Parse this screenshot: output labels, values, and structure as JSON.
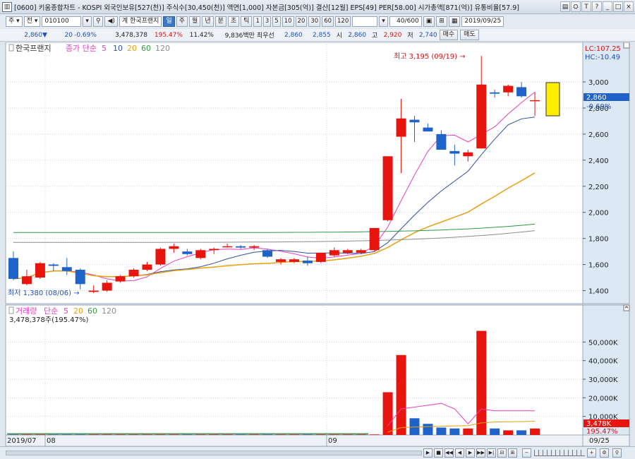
{
  "titlebar": {
    "icon": "chart-window-icon",
    "text": "[0600] 키움종합차트 - KOSPI 외국인보유[527(천)] 주식수[30,450(천)] 액면[1,000] 자본금[305(억)] 결산[12월] EPS[49] PER[58.00] 시가총액[871(억)] 유통비율[57.9]",
    "buttons": [
      "▤",
      "⛭",
      "T",
      "?",
      "_",
      "□",
      "×"
    ]
  },
  "toolbar1": {
    "market": "주",
    "scope": "전",
    "code": "010100",
    "stock_name_prefix": "계",
    "stock_name": "한국프랜지",
    "periods": [
      "일",
      "주",
      "월",
      "년",
      "분",
      "초",
      "틱"
    ],
    "selected_period": "일",
    "minutes": [
      "1",
      "3",
      "5",
      "10",
      "20",
      "30",
      "60",
      "120"
    ],
    "count": "40/600",
    "date": "2019/09/25"
  },
  "quote": {
    "price": "2,860",
    "change": "20",
    "change_pct": "-0.69%",
    "volume": "3,478,378",
    "volume_ratio": "195.47%",
    "turnover": "11.42%",
    "amount": "9,836백만",
    "best_label": "최우선",
    "ask": "2,860",
    "bid": "2,855",
    "open_label": "시",
    "open": "2,860",
    "high_label": "고",
    "high": "2,920",
    "low_label": "저",
    "low": "2,740",
    "buy_label": "매수",
    "sell_label": "매도"
  },
  "price_pane": {
    "legend_name": "한국프랜지",
    "ma_label": "종가 단순",
    "ma_periods": [
      "5",
      "10",
      "20",
      "60",
      "120"
    ],
    "lc": "LC:107.25",
    "hc": "HC:-10.49",
    "high_annotation": "최고 3,195 (09/19) →",
    "low_annotation": "최저 1,380 (08/06) →",
    "current_price": "2,860",
    "current_change": "-0.69%"
  },
  "volume_pane": {
    "legend_name": "거래량",
    "ma_label": "단순",
    "ma_periods": [
      "5",
      "20",
      "60",
      "120"
    ],
    "current_value_text": "3,478,378주(195.47%)",
    "current_label": "3,478K",
    "current_ratio": "195.47%"
  },
  "x_labels": [
    "2019/07",
    "08",
    "09",
    "09/25"
  ],
  "colors": {
    "up": "#e8150f",
    "down": "#1f63c9",
    "ma5": "#e83fbf",
    "ma10": "#2f4fa8",
    "ma20": "#e6a010",
    "ma60": "#2e9a46",
    "ma120": "#8c8c8c",
    "highlight": "#ffee00"
  },
  "chart_data": {
    "type": "candlestick",
    "y_ticks": [
      "1,400",
      "1,600",
      "1,800",
      "2,000",
      "2,200",
      "2,400",
      "2,600",
      "2,800",
      "3,000"
    ],
    "ylim": [
      1300,
      3260
    ],
    "volume_ticks": [
      "10,000K",
      "20,000K",
      "30,000K",
      "40,000K",
      "50,000K"
    ],
    "volume_ylim": [
      0,
      60000
    ],
    "candles": [
      {
        "o": 1650,
        "h": 1700,
        "l": 1480,
        "c": 1490,
        "v": 300
      },
      {
        "o": 1450,
        "h": 1560,
        "l": 1440,
        "c": 1510,
        "v": 300
      },
      {
        "o": 1500,
        "h": 1620,
        "l": 1490,
        "c": 1610,
        "v": 300
      },
      {
        "o": 1600,
        "h": 1610,
        "l": 1550,
        "c": 1590,
        "v": 300
      },
      {
        "o": 1580,
        "h": 1650,
        "l": 1520,
        "c": 1550,
        "v": 300
      },
      {
        "o": 1560,
        "h": 1570,
        "l": 1410,
        "c": 1450,
        "v": 300
      },
      {
        "o": 1390,
        "h": 1440,
        "l": 1380,
        "c": 1400,
        "v": 300
      },
      {
        "o": 1400,
        "h": 1480,
        "l": 1390,
        "c": 1460,
        "v": 300
      },
      {
        "o": 1470,
        "h": 1520,
        "l": 1460,
        "c": 1510,
        "v": 300
      },
      {
        "o": 1510,
        "h": 1570,
        "l": 1500,
        "c": 1560,
        "v": 300
      },
      {
        "o": 1560,
        "h": 1620,
        "l": 1550,
        "c": 1600,
        "v": 300
      },
      {
        "o": 1600,
        "h": 1730,
        "l": 1590,
        "c": 1720,
        "v": 300
      },
      {
        "o": 1720,
        "h": 1760,
        "l": 1690,
        "c": 1740,
        "v": 300
      },
      {
        "o": 1700,
        "h": 1720,
        "l": 1670,
        "c": 1680,
        "v": 300
      },
      {
        "o": 1650,
        "h": 1720,
        "l": 1640,
        "c": 1710,
        "v": 300
      },
      {
        "o": 1710,
        "h": 1730,
        "l": 1680,
        "c": 1720,
        "v": 300
      },
      {
        "o": 1740,
        "h": 1760,
        "l": 1730,
        "c": 1740,
        "v": 300
      },
      {
        "o": 1740,
        "h": 1750,
        "l": 1720,
        "c": 1730,
        "v": 300
      },
      {
        "o": 1730,
        "h": 1750,
        "l": 1710,
        "c": 1740,
        "v": 300
      },
      {
        "o": 1710,
        "h": 1720,
        "l": 1650,
        "c": 1660,
        "v": 300
      },
      {
        "o": 1620,
        "h": 1650,
        "l": 1600,
        "c": 1640,
        "v": 300
      },
      {
        "o": 1620,
        "h": 1650,
        "l": 1610,
        "c": 1640,
        "v": 300
      },
      {
        "o": 1630,
        "h": 1660,
        "l": 1590,
        "c": 1610,
        "v": 300
      },
      {
        "o": 1620,
        "h": 1690,
        "l": 1610,
        "c": 1690,
        "v": 300
      },
      {
        "o": 1670,
        "h": 1730,
        "l": 1660,
        "c": 1710,
        "v": 300
      },
      {
        "o": 1690,
        "h": 1720,
        "l": 1680,
        "c": 1710,
        "v": 300
      },
      {
        "o": 1690,
        "h": 1720,
        "l": 1680,
        "c": 1710,
        "v": 300
      },
      {
        "o": 1710,
        "h": 1880,
        "l": 1700,
        "c": 1880,
        "v": 300
      },
      {
        "o": 1940,
        "h": 2430,
        "l": 1930,
        "c": 2430,
        "v": 23000
      },
      {
        "o": 2580,
        "h": 2870,
        "l": 2300,
        "c": 2720,
        "v": 43000
      },
      {
        "o": 2710,
        "h": 2740,
        "l": 2540,
        "c": 2690,
        "v": 9000
      },
      {
        "o": 2650,
        "h": 2680,
        "l": 2620,
        "c": 2620,
        "v": 6000
      },
      {
        "o": 2600,
        "h": 2630,
        "l": 2480,
        "c": 2480,
        "v": 4000
      },
      {
        "o": 2470,
        "h": 2520,
        "l": 2360,
        "c": 2450,
        "v": 3500
      },
      {
        "o": 2430,
        "h": 2480,
        "l": 2390,
        "c": 2460,
        "v": 3500
      },
      {
        "o": 2490,
        "h": 3200,
        "l": 2490,
        "c": 2980,
        "v": 56000
      },
      {
        "o": 2920,
        "h": 2940,
        "l": 2880,
        "c": 2910,
        "v": 3500
      },
      {
        "o": 2920,
        "h": 2980,
        "l": 2890,
        "c": 2970,
        "v": 2500
      },
      {
        "o": 2960,
        "h": 3000,
        "l": 2880,
        "c": 2890,
        "v": 2500
      },
      {
        "o": 2860,
        "h": 2920,
        "l": 2740,
        "c": 2860,
        "v": 3478
      }
    ],
    "ma_volume5": [
      null,
      null,
      null,
      null,
      null,
      null,
      null,
      null,
      null,
      null,
      null,
      null,
      null,
      null,
      null,
      null,
      null,
      null,
      null,
      null,
      null,
      null,
      null,
      null,
      null,
      null,
      null,
      null,
      5000,
      14000,
      15000,
      16000,
      17000,
      14000,
      6000,
      14000,
      13000,
      13000,
      13000,
      13000
    ],
    "ma_volume20": [
      null,
      null,
      null,
      null,
      null,
      null,
      null,
      null,
      null,
      null,
      null,
      null,
      null,
      null,
      null,
      null,
      null,
      null,
      null,
      null,
      null,
      null,
      null,
      null,
      null,
      null,
      null,
      null,
      1500,
      4000,
      4300,
      4500,
      4700,
      4900,
      5000,
      6500,
      7000,
      7100,
      7200,
      7400
    ]
  }
}
